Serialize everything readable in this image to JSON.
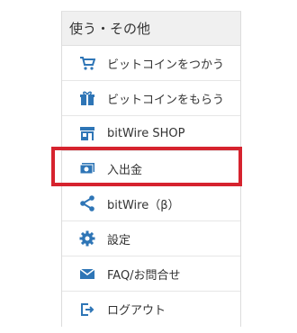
{
  "panel": {
    "header": "使う・その他",
    "accent_color": "#2e75b6",
    "highlight_color": "#d6232e",
    "highlighted_item": "入出金",
    "items": [
      {
        "label": "ビットコインをつかう",
        "icon": "cart-icon"
      },
      {
        "label": "ビットコインをもらう",
        "icon": "gift-icon"
      },
      {
        "label": "bitWire SHOP",
        "icon": "shop-icon"
      },
      {
        "label": "入出金",
        "icon": "cash-icon"
      },
      {
        "label": "bitWire（β）",
        "icon": "share-icon"
      },
      {
        "label": "設定",
        "icon": "gear-icon"
      },
      {
        "label": "FAQ/お問合せ",
        "icon": "mail-icon"
      },
      {
        "label": "ログアウト",
        "icon": "logout-icon"
      }
    ]
  }
}
